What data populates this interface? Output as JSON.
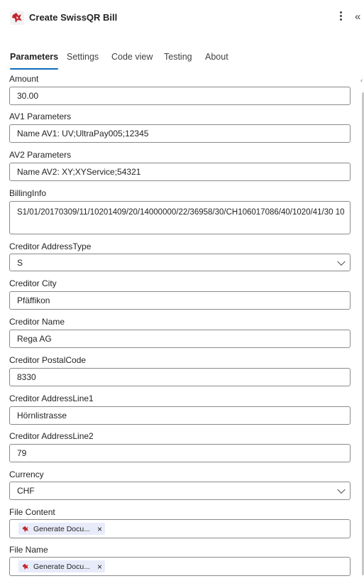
{
  "header": {
    "title": "Create SwissQR Bill",
    "icon": "app-logo-icon",
    "more_icon": "more-vertical-icon",
    "collapse_icon": "double-chevron-left-icon",
    "collapse_glyph": "«"
  },
  "tabs": [
    {
      "label": "Parameters",
      "active": true
    },
    {
      "label": "Settings",
      "active": false
    },
    {
      "label": "Code view",
      "active": false
    },
    {
      "label": "Testing",
      "active": false
    },
    {
      "label": "About",
      "active": false
    }
  ],
  "fields": {
    "amount": {
      "label": "Amount",
      "value": "30.00"
    },
    "av1": {
      "label": "AV1 Parameters",
      "value": "Name AV1: UV;UltraPay005;12345"
    },
    "av2": {
      "label": "AV2 Parameters",
      "value": "Name AV2: XY;XYService;54321"
    },
    "billing": {
      "label": "BillingInfo",
      "value": "S1/01/20170309/11/10201409/20/14000000/22/36958/30/CH106017086/40/1020/41/30 10"
    },
    "address_type": {
      "label": "Creditor AddressType",
      "value": "S"
    },
    "city": {
      "label": "Creditor City",
      "value": "Pfäffikon"
    },
    "name": {
      "label": "Creditor Name",
      "value": "Rega AG"
    },
    "postal": {
      "label": "Creditor PostalCode",
      "value": "8330"
    },
    "line1": {
      "label": "Creditor AddressLine1",
      "value": "Hörnlistrasse"
    },
    "line2": {
      "label": "Creditor AddressLine2",
      "value": "79"
    },
    "currency": {
      "label": "Currency",
      "value": "CHF"
    },
    "file_content": {
      "label": "File Content",
      "token": "Generate Docu...",
      "token_close": "×"
    },
    "file_name": {
      "label": "File Name",
      "token": "Generate Docu...",
      "token_close": "×"
    }
  },
  "colors": {
    "accent": "#0f6cbd",
    "token_bg": "#e8ebfa",
    "border": "#8a8a8a",
    "logo_red": "#c4262e"
  }
}
